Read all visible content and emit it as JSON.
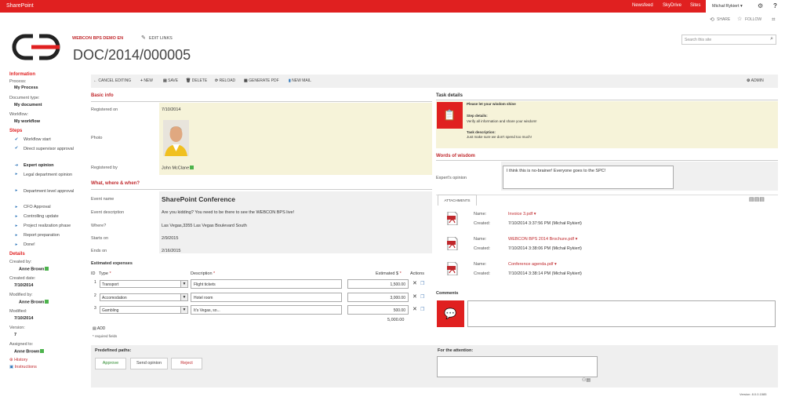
{
  "suitebar": {
    "brand": "SharePoint",
    "links": [
      "Newsfeed",
      "SkyDrive",
      "Sites"
    ],
    "user": "Michał Rykiert ▾"
  },
  "actions": {
    "share": "SHARE",
    "follow": "FOLLOW"
  },
  "header": {
    "site_link": "WEBCON BPS DEMO EN",
    "edit_links": "EDIT LINKS",
    "title": "DOC/2014/000005",
    "search_placeholder": "Search this site"
  },
  "left": {
    "info_title": "Information",
    "process_label": "Process:",
    "process_value": "My Process",
    "doctype_label": "Document type:",
    "doctype_value": "My document",
    "workflow_label": "Workflow:",
    "workflow_value": "My workflow",
    "steps_title": "Steps",
    "steps": [
      {
        "label": "Workflow start",
        "mark": "✔"
      },
      {
        "label": "Direct supervisor approval",
        "mark": "✔"
      },
      {
        "label": "Expert opinion",
        "mark": "➔"
      },
      {
        "label": "Legal department opinion",
        "mark": "▸"
      },
      {
        "label": "Department level approval",
        "mark": "▸"
      },
      {
        "label": "CFO Approval",
        "mark": "▸"
      },
      {
        "label": "Controlling update",
        "mark": "▸"
      },
      {
        "label": "Project realization phase",
        "mark": "▸"
      },
      {
        "label": "Report preparation",
        "mark": "▸"
      },
      {
        "label": "Done!",
        "mark": "▸"
      }
    ],
    "details_title": "Details",
    "created_by_label": "Created by:",
    "created_by": "Anne Brown",
    "created_date_label": "Created date:",
    "created_date": "7/10/2014",
    "modified_by_label": "Modified by:",
    "modified_by": "Anne Brown",
    "modified_label": "Modified:",
    "modified": "7/10/2014",
    "version_label": "Version:",
    "version": "7",
    "assigned_label": "Assigned to:",
    "assigned": "Anne Brown",
    "history": "History",
    "instructions": "Instructions"
  },
  "toolbar": {
    "cancel": "CANCEL EDITING",
    "new": "NEW",
    "save": "SAVE",
    "delete": "DELETE",
    "reload": "RELOAD",
    "pdf": "GENERATE PDF",
    "mail": "NEW MAIL",
    "admin": "ADMIN"
  },
  "basic": {
    "title": "Basic info",
    "registered_on_label": "Registered on",
    "registered_on": "7/10/2014",
    "photo_label": "Photo",
    "registered_by_label": "Registered by",
    "registered_by": "John McClane"
  },
  "www": {
    "title": "What, where & when?",
    "event_name_label": "Event name",
    "event_name": "SharePoint Conference",
    "event_desc_label": "Event description",
    "event_desc": "Are you kidding? You need to be there to see the WEBCON BPS live!",
    "where_label": "Where?",
    "where": "Las Vegas,3355 Las Vegas Boulevard South",
    "starts_label": "Starts on",
    "starts": "2/9/2015",
    "ends_label": "Ends on",
    "ends": "2/16/2015"
  },
  "expenses": {
    "title": "Estimated expenses",
    "col_id": "ID",
    "col_type": "Type",
    "col_desc": "Description",
    "col_est": "Estimated $",
    "col_actions": "Actions",
    "rows": [
      {
        "id": "1",
        "type": "Transport",
        "desc": "Flight tickets",
        "est": "1,500.00"
      },
      {
        "id": "2",
        "type": "Accomodation",
        "desc": "Hotel room",
        "est": "3,000.00"
      },
      {
        "id": "3",
        "type": "Gambling",
        "desc": "It's Vegas, so...",
        "est": "500.00"
      }
    ],
    "total": "5,000.00",
    "add": "ADD",
    "required": "* required fields"
  },
  "task": {
    "title": "Task details",
    "line1": "Please let your wisdom shine",
    "step_title": "Step details:",
    "step_text": "Verify all information and share your wisdom!",
    "desc_title": "Task description:",
    "desc_text": "Just make sure we don't spend too much!"
  },
  "wisdom": {
    "title": "Words of wisdom",
    "opinion_label": "Expert's opinion",
    "opinion": "I think this is no-brainer! Everyone goes to the SPC!"
  },
  "attachments": {
    "tab": "ATTACHMENTS",
    "name_label": "Name:",
    "created_label": "Created:",
    "items": [
      {
        "name": "Invoice 3.pdf",
        "created": "7/10/2014 3:37:56 PM (Michał Rykiert)"
      },
      {
        "name": "WEBCON BPS 2014 Brochure.pdf",
        "created": "7/10/2014 3:38:06 PM (Michał Rykiert)"
      },
      {
        "name": "Conference agenda.pdf",
        "created": "7/10/2014 3:38:14 PM (Michał Rykiert)"
      }
    ]
  },
  "comments": {
    "title": "Comments"
  },
  "paths": {
    "title": "Predefined paths:",
    "approve": "Approve",
    "send": "Send opinion",
    "reject": "Reject",
    "attention": "For the attention:"
  },
  "version": "Version: 8.0.0.1585",
  "colors": {
    "accent": "#e02020",
    "link": "#c0282c",
    "highlight": "#f6f3d9",
    "status_green": "#4db34d"
  }
}
